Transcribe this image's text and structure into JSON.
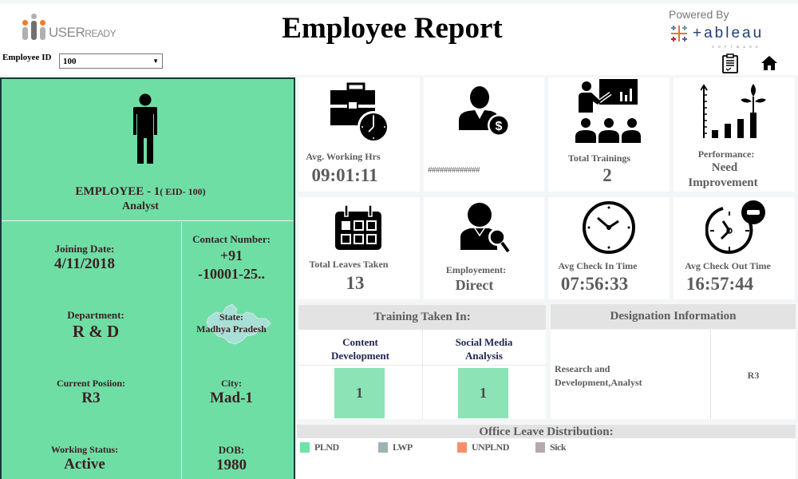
{
  "header": {
    "logo_text_main": "USER",
    "logo_text_rest": "EADY",
    "title": "Employee Report",
    "powered_by": "Powered By",
    "tableau_word": "+ableau",
    "tableau_sub": "SOFTWARE"
  },
  "filter": {
    "label": "Employee ID",
    "value": "100"
  },
  "icons": {
    "report": "clipboard-icon",
    "home": "home-icon"
  },
  "employee": {
    "name": "EMPLOYEE - 1",
    "eid": "( EID- 100)",
    "role": "Analyst",
    "fields": {
      "joining_date": {
        "label": "Joining Date:",
        "value": "4/11/2018"
      },
      "contact": {
        "label": "Contact Number:",
        "value_line1": "+91",
        "value_line2": "-10001-25.."
      },
      "department": {
        "label": "Department:",
        "value": "R & D"
      },
      "state": {
        "label": "State:",
        "value": "Madhya Pradesh"
      },
      "position": {
        "label": "Current Posiion:",
        "value": "R3"
      },
      "city": {
        "label": "City:",
        "value": "Mad-1"
      },
      "working_status": {
        "label": "Working Status:",
        "value": "Active"
      },
      "dob": {
        "label": "DOB:",
        "value": "1980"
      }
    }
  },
  "cards": {
    "avg_working_hrs": {
      "label": "Avg. Working Hrs",
      "value": "09:01:11"
    },
    "salary": {
      "value": "#############"
    },
    "total_trainings": {
      "label": "Total Trainings",
      "value": "2"
    },
    "performance": {
      "label": "Performance:",
      "value_line1": "Need",
      "value_line2": "Improvement"
    },
    "total_leaves": {
      "label": "Total Leaves Taken",
      "value": "13"
    },
    "employment": {
      "label": "Employement:",
      "value": "Direct"
    },
    "avg_check_in": {
      "label": "Avg Check In Time",
      "value": "07:56:33"
    },
    "avg_check_out": {
      "label": "Avg Check Out Time",
      "value": "16:57:44"
    }
  },
  "training": {
    "title": "Training Taken In:",
    "items": [
      {
        "name_line1": "Content",
        "name_line2": "Development",
        "count": "1"
      },
      {
        "name_line1": "Social Media",
        "name_line2": "Analysis",
        "count": "1"
      }
    ]
  },
  "designation": {
    "title": "Designation Information",
    "line1": "Research and",
    "line2": "Development,Analyst",
    "code": "R3"
  },
  "leave_distribution": {
    "title": "Office Leave Distribution:",
    "legend": [
      {
        "label": "PLND",
        "color": "#6fe3a6"
      },
      {
        "label": "LWP",
        "color": "#9db3b5"
      },
      {
        "label": "UNPLND",
        "color": "#f88f6c"
      },
      {
        "label": "Sick",
        "color": "#b5aaaa"
      }
    ]
  },
  "colors": {
    "panel_green": "#6fdea5",
    "panel_border": "#143a3a",
    "training_box": "#8be3b6"
  }
}
